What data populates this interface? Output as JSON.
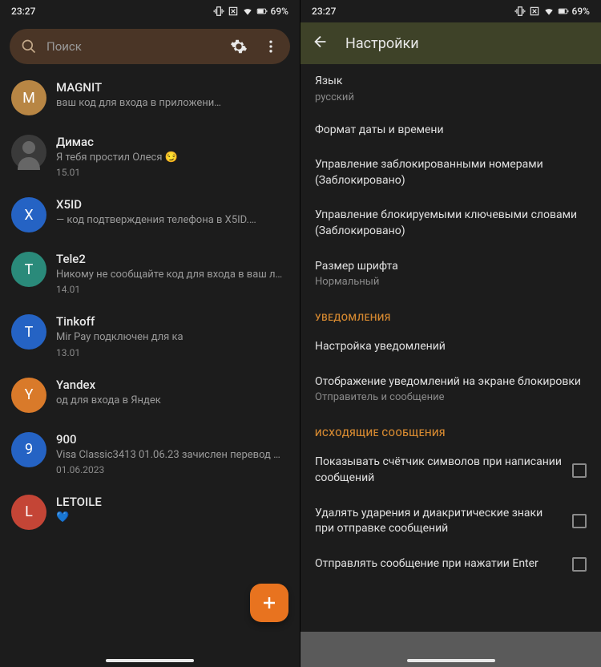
{
  "status": {
    "time": "23:27",
    "battery": "69%"
  },
  "search": {
    "placeholder": "Поиск"
  },
  "chats": [
    {
      "name": "MAGNIT",
      "preview": "ваш код для входа в приложени…",
      "date": "",
      "avatar": {
        "letter": "M",
        "color": "#b88644"
      }
    },
    {
      "name": "Димас",
      "preview": "Я тебя простил Олеся 😏",
      "date": "15.01",
      "avatar": {
        "img": true
      }
    },
    {
      "name": "X5ID",
      "preview": "— код подтверждения телефона в X5ID.…",
      "date": "",
      "avatar": {
        "letter": "X",
        "color": "#2563c4"
      }
    },
    {
      "name": "Tele2",
      "preview": "Никому не сообщайте код для входа в ваш л…",
      "date": "14.01",
      "avatar": {
        "letter": "T",
        "color": "#2a8a7a"
      }
    },
    {
      "name": "Tinkoff",
      "preview": "Mir Pay подключен для ка",
      "date": "13.01",
      "avatar": {
        "letter": "T",
        "color": "#2563c4"
      }
    },
    {
      "name": "Yandex",
      "preview": "од для входа в Яндек",
      "date": "",
      "avatar": {
        "letter": "Y",
        "color": "#d97a2a"
      }
    },
    {
      "name": "900",
      "preview": "Visa Classic3413 01.06.23 зачислен перевод …",
      "date": "01.06.2023",
      "avatar": {
        "letter": "9",
        "color": "#2563c4"
      }
    },
    {
      "name": "LETOILE",
      "preview": "💙",
      "date": "",
      "avatar": {
        "letter": "L",
        "color": "#c44536"
      }
    }
  ],
  "settings": {
    "title": "Настройки",
    "items": [
      {
        "label": "Язык",
        "sub": "русский"
      },
      {
        "label": "Формат даты и времени"
      },
      {
        "label": "Управление заблокированными номерами (Заблокировано)"
      },
      {
        "label": "Управление блокируемыми ключевыми словами (Заблокировано)"
      },
      {
        "label": "Размер шрифта",
        "sub": "Нормальный"
      }
    ],
    "notifications": {
      "header": "УВЕДОМЛЕНИЯ",
      "items": [
        {
          "label": "Настройка уведомлений"
        },
        {
          "label": "Отображение уведомлений на экране блокировки",
          "sub": "Отправитель и сообщение"
        }
      ]
    },
    "outgoing": {
      "header": "ИСХОДЯЩИЕ СООБЩЕНИЯ",
      "items": [
        {
          "label": "Показывать счётчик символов при написании сообщений",
          "checkbox": true
        },
        {
          "label": "Удалять ударения и диакритические знаки при отправке сообщений",
          "checkbox": true
        },
        {
          "label": "Отправлять сообщение при нажатии Enter",
          "checkbox": true
        }
      ]
    }
  }
}
